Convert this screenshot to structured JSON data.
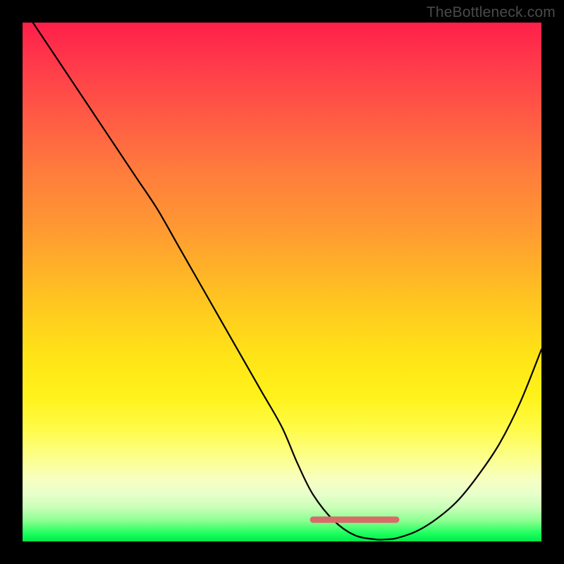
{
  "watermark": "TheBottleneck.com",
  "chart_data": {
    "type": "line",
    "title": "",
    "xlabel": "",
    "ylabel": "",
    "xlim": [
      0,
      100
    ],
    "ylim": [
      0,
      100
    ],
    "grid": false,
    "series": [
      {
        "name": "bottleneck-curve",
        "x": [
          2,
          6,
          10,
          14,
          18,
          22,
          26,
          30,
          34,
          38,
          42,
          46,
          50,
          53,
          56,
          60,
          64,
          68,
          70,
          72,
          76,
          80,
          84,
          88,
          92,
          96,
          100
        ],
        "y": [
          100,
          94,
          88,
          82,
          76,
          70,
          64,
          57,
          50,
          43,
          36,
          29,
          22,
          15,
          9,
          4,
          1.2,
          0.4,
          0.4,
          0.6,
          2.0,
          4.5,
          8,
          13,
          19,
          27,
          37
        ]
      }
    ],
    "annotations": [
      {
        "name": "optimal-band",
        "type": "segment",
        "x0": 56,
        "y0": 4.2,
        "x1": 72,
        "y1": 4.2,
        "color": "#d96a6a",
        "width": 9,
        "cap": "round"
      }
    ]
  }
}
